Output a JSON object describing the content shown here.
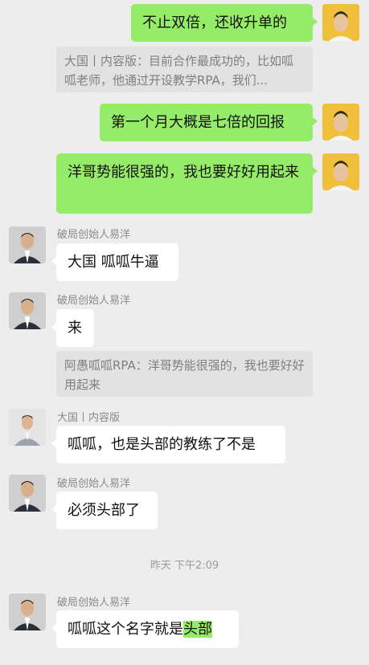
{
  "messages": {
    "m1_text": "不止双倍，还收升单的",
    "q1_text": "大国丨内容版：目前合作最成功的，比如呱呱老师，他通过开设教学RPA，我们...",
    "m2_text": "第一个月大概是七倍的回报",
    "m3_text": "洋哥势能很强的，我也要好好用起来",
    "s1_sender": "破局创始人易洋",
    "s1_text": "大国 呱呱牛逼",
    "s2_sender": "破局创始人易洋",
    "s2_text": "来",
    "q2_text": "阿愚呱呱RPA：洋哥势能很强的，我也要好好用起来",
    "s3_sender": "大国丨内容版",
    "s3_text": "呱呱，也是头部的教练了不是",
    "s4_sender": "破局创始人易洋",
    "s4_text": "必须头部了",
    "timestamp": "昨天 下午2:09",
    "s5_sender": "破局创始人易洋",
    "s5_text_before": "呱呱这个名字就是",
    "s5_text_highlight": "头部"
  },
  "colors": {
    "background": "#ededed",
    "own_bubble": "#95ec69",
    "other_bubble": "#ffffff",
    "quote_bg": "#e2e2e2"
  },
  "icons": {
    "own_avatar": "avatar-man-yellow-bg",
    "yiyang_avatar": "avatar-man-suit",
    "daguo_avatar": "avatar-man-gray-bg"
  }
}
